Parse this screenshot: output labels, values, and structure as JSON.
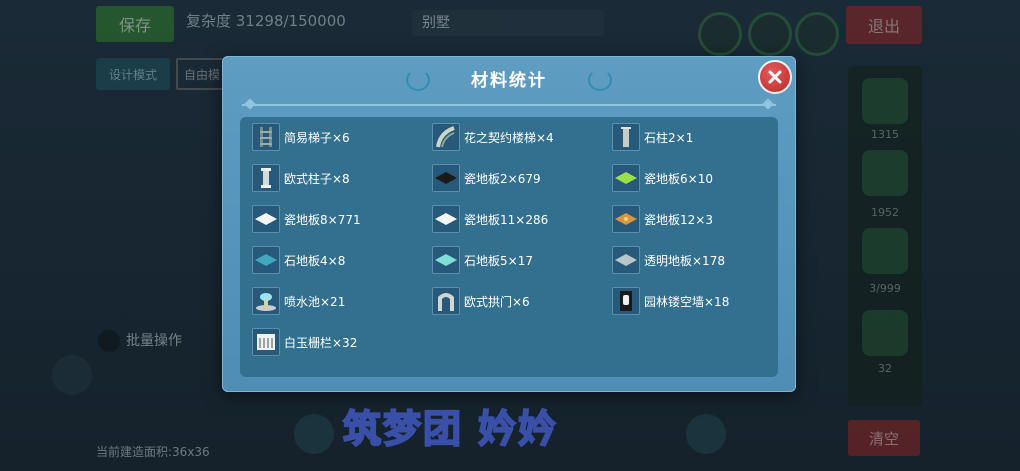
{
  "background": {
    "save_label": "保存",
    "complexity_text": "复杂度 31298/150000",
    "search_text": "别墅",
    "exit_label": "退出",
    "design_mode_label": "设计模式",
    "free_label": "自由模",
    "batch_label": "批量操作",
    "area_label": "当前建造面积:36x36",
    "clear_label": "清空",
    "right_counts": [
      "1315",
      "1952",
      "3/999",
      "32"
    ]
  },
  "dialog": {
    "title": "材料统计",
    "items": [
      {
        "icon": "ladder-icon",
        "label": "简易梯子×6"
      },
      {
        "icon": "spiral-stairs-icon",
        "label": "花之契约楼梯×4"
      },
      {
        "icon": "stone-pillar-icon",
        "label": "石柱2×1"
      },
      {
        "icon": "european-column-icon",
        "label": "欧式柱子×8"
      },
      {
        "icon": "black-tile-icon",
        "label": "瓷地板2×679"
      },
      {
        "icon": "green-tile-icon",
        "label": "瓷地板6×10"
      },
      {
        "icon": "white-tile-icon",
        "label": "瓷地板8×771"
      },
      {
        "icon": "white-tile-icon",
        "label": "瓷地板11×286"
      },
      {
        "icon": "patterned-tile-icon",
        "label": "瓷地板12×3"
      },
      {
        "icon": "blue-stone-tile-icon",
        "label": "石地板4×8"
      },
      {
        "icon": "cyan-stone-tile-icon",
        "label": "石地板5×17"
      },
      {
        "icon": "glass-floor-icon",
        "label": "透明地板×178"
      },
      {
        "icon": "fountain-icon",
        "label": "喷水池×21"
      },
      {
        "icon": "european-arch-icon",
        "label": "欧式拱门×6"
      },
      {
        "icon": "garden-wall-icon",
        "label": "园林镂空墙×18"
      },
      {
        "icon": "white-jade-fence-icon",
        "label": "白玉栅栏×32"
      }
    ]
  },
  "watermark": {
    "text": "筑梦团  妗妗"
  }
}
